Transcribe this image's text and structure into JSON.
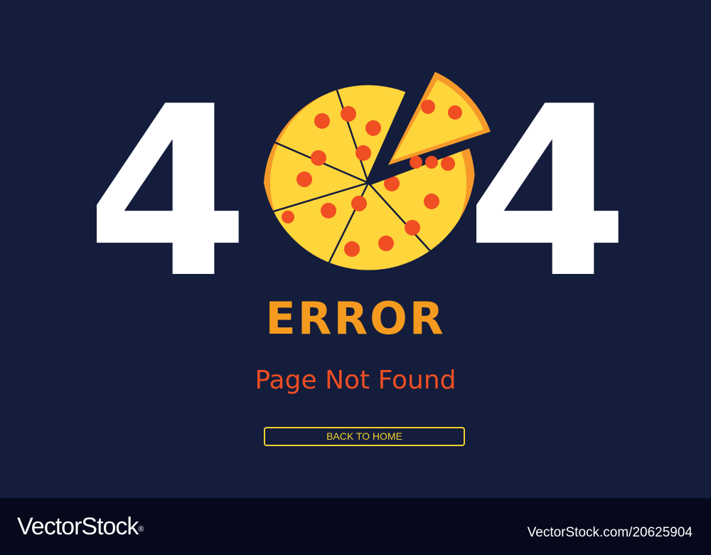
{
  "hero": {
    "code_left": "4",
    "code_right": "4",
    "pizza_icon": "pizza-icon"
  },
  "error_title": "ERROR",
  "error_subtitle": "Page Not Found",
  "home_button": "BACK TO HOME",
  "footer": {
    "logo_text": "VectorStock",
    "logo_mark": "®",
    "image_id": "VectorStock.com/20625904"
  },
  "colors": {
    "background": "#141d3c",
    "footer": "#06091b",
    "digits": "#ffffff",
    "title": "#f49b1f",
    "subtitle": "#f04e23",
    "button": "#f2d12e",
    "pizza_crust": "#f59a2a",
    "pizza_cheese": "#fed53b",
    "pepperoni": "#f04e23"
  }
}
